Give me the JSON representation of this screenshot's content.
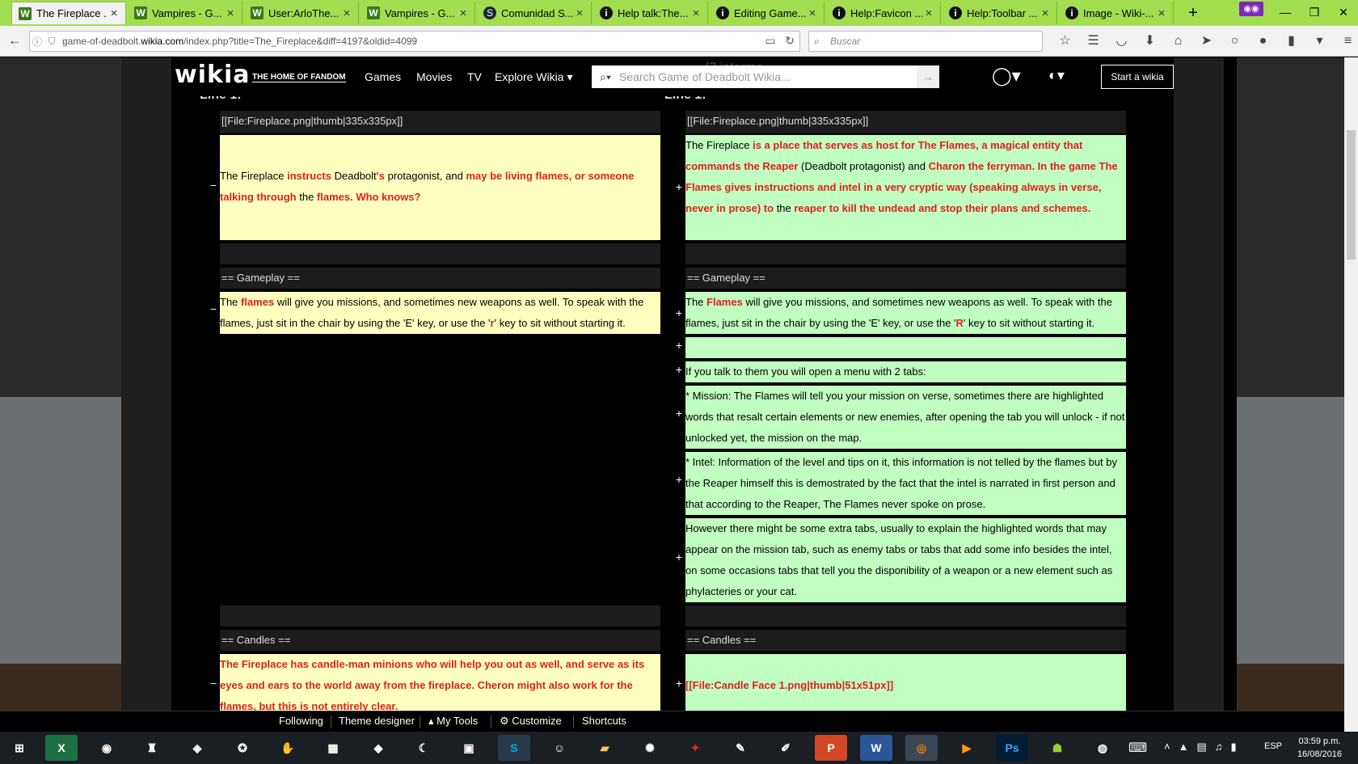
{
  "browser": {
    "tabs": [
      {
        "title": "The Fireplace ...",
        "icon": "wikia-icon",
        "active": true
      },
      {
        "title": "Vampires - G...",
        "icon": "wikia-icon"
      },
      {
        "title": "User:ArloThe...",
        "icon": "wikia-icon"
      },
      {
        "title": "Vampires - G...",
        "icon": "wikia-icon"
      },
      {
        "title": "Comunidad S...",
        "icon": "steam-icon"
      },
      {
        "title": "Help talk:The...",
        "icon": "info-icon"
      },
      {
        "title": "Editing Game...",
        "icon": "info-icon"
      },
      {
        "title": "Help:Favicon ...",
        "icon": "info-icon"
      },
      {
        "title": "Help:Toolbar ...",
        "icon": "info-icon"
      },
      {
        "title": "Image - Wiki-...",
        "icon": "info-icon"
      }
    ],
    "url_prefix": "game-of-deadbolt.",
    "url_domain": "wikia.com",
    "url_path": "/index.php?title=The_Fireplace&diff=4197&oldid=4099",
    "search_placeholder": "Buscar"
  },
  "wikia": {
    "logo": "wikia",
    "tagline": "THE HOME OF FANDOM",
    "nav": [
      "Games",
      "Movies",
      "TV",
      "Explore Wikia"
    ],
    "search_placeholder": "Search Game of Deadbolt Wikia...",
    "start_button": "Start a wikia",
    "intermediate": "(3 interme"
  },
  "diff": {
    "left_line": "Line 1:",
    "right_line": "Line 1:",
    "row1_ctx": "[[File:Fireplace.png|thumb|335x335px]]",
    "row2_left": {
      "t1": "The Fireplace ",
      "r1": "instructs",
      "t2": " Deadbolt",
      "r2": "'s",
      "t3": " protagonist, and ",
      "r3": "may be living flames, or someone talking through",
      "t4": " the ",
      "r4": "flames. Who knows?"
    },
    "row2_right": {
      "t1": "The Fireplace ",
      "r1": "is a place that serves as host for The Flames, a magical entity that commands the Reaper",
      "t2": " (Deadbolt protagonist) and ",
      "r2": "Charon the ferryman. In the game The Flames gives instructions and intel in a very cryptic way (speaking always in verse, never in prose) to",
      "t3": " the ",
      "r3": "reaper to kill the undead and stop their plans and schemes."
    },
    "gameplay_ctx": "== Gameplay ==",
    "row4_left": {
      "t1": "The ",
      "r1": "flames",
      "t2": " will give you missions, and sometimes new weapons as well. To speak with the flames, just sit in the chair by using the 'E' key, or use the '",
      "r2": "r",
      "t3": "' key to sit without starting it."
    },
    "row4_right": {
      "t1": "The ",
      "r1": "Flames",
      "t2": " will give you missions, and sometimes new weapons as well. To speak with the flames, just sit in the chair by using the 'E' key, or use the '",
      "r2": "R",
      "t3": "' key to sit without starting it."
    },
    "added_lines": [
      "If you talk to them you will open a menu with 2 tabs:",
      "* Mission: The Flames will tell you your mission on verse, sometimes there are highlighted words that resalt certain elements or new enemies, after opening the tab you will unlock - if not unlocked yet, the mission on the map.",
      "* Intel: Information of the level and tips on it, this information is not telled by the flames but by the Reaper himself this is demostrated by the fact that the intel is narrated in first person and that according to the Reaper, The Flames never spoke on prose.",
      "However there might be some extra tabs, usually to explain the highlighted words that may appear on the mission tab, such as enemy tabs or tabs that add some info besides the intel, on some occasions tabs that tell you the disponibility of a weapon or a new element such as phylacteries or your cat."
    ],
    "candles_ctx": "== Candles ==",
    "candles_left": "The Fireplace has candle-man minions who will help you out as well, and serve as its eyes and ears to the world away from the fireplace. Cheron might also work for the flames, but this is not entirely clear.",
    "candles_right": "[[File:Candle Face 1.png|thumb|51x51px]]",
    "minus": "−",
    "plus": "+"
  },
  "wikia_toolbar": {
    "items": [
      "Following",
      "Theme designer",
      "My Tools",
      "Customize",
      "Shortcuts"
    ]
  },
  "taskbar": {
    "lang": "ESP",
    "time": "03:59 p.m.",
    "date": "16/08/2016",
    "apps": [
      "start",
      "excel",
      "chrome",
      "app",
      "app",
      "app",
      "app",
      "calculator",
      "app",
      "app",
      "app",
      "skype",
      "app",
      "explorer",
      "app",
      "app",
      "app",
      "app",
      "powerpoint",
      "word",
      "firefox",
      "media",
      "photoshop",
      "app",
      "steam"
    ]
  },
  "colors": {
    "tabstrip": "#a3dd50",
    "deleted": "#ffffc0",
    "added": "#c0ffc0",
    "changed_text": "#e02020"
  }
}
